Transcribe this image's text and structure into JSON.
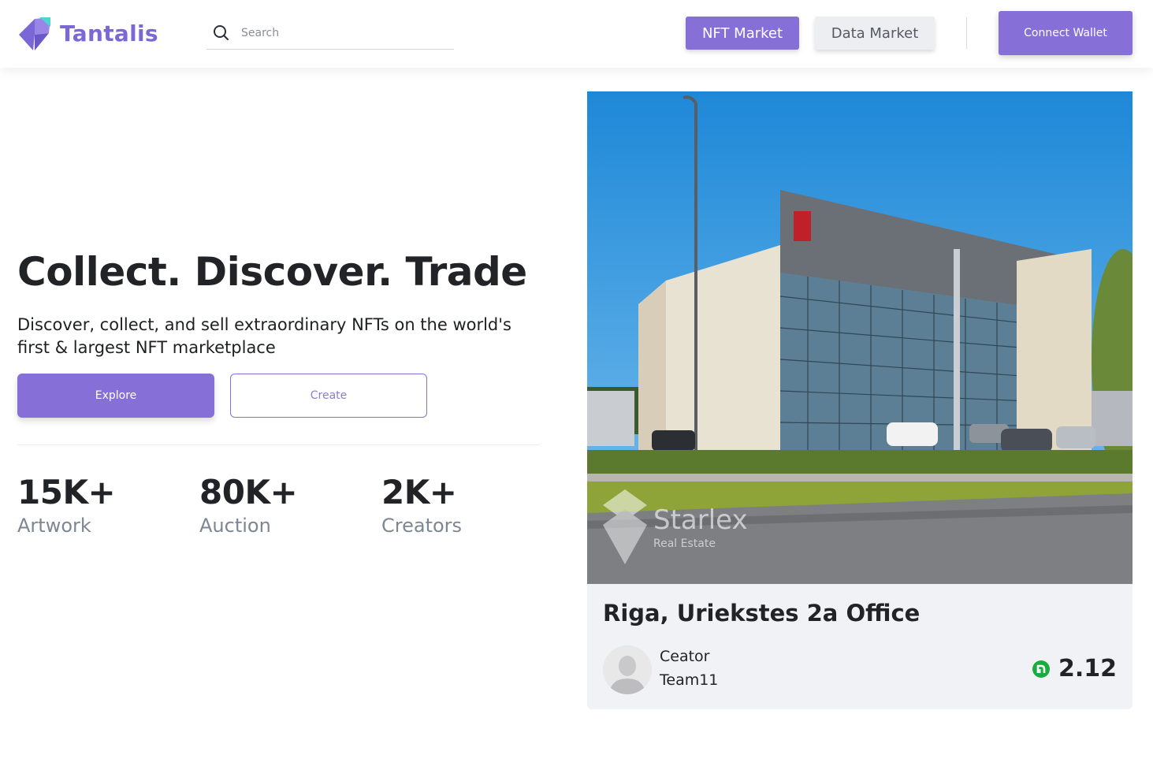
{
  "header": {
    "brand": "Tantalis",
    "search_placeholder": "Search",
    "nav": {
      "nft_market": "NFT Market",
      "data_market": "Data Market"
    },
    "connect_wallet": "Connect Wallet"
  },
  "hero": {
    "title": "Collect. Discover. Trade",
    "subtitle": "Discover, collect, and sell extraordinary NFTs on the world's first & largest NFT marketplace",
    "explore_label": "Explore",
    "create_label": "Create",
    "stats": [
      {
        "value": "15K+",
        "label": "Artwork"
      },
      {
        "value": "80K+",
        "label": "Auction"
      },
      {
        "value": "2K+",
        "label": "Creators"
      }
    ]
  },
  "card": {
    "image_watermark": "Starlex",
    "image_watermark_sub": "Real Estate",
    "title": "Riga, Uriekstes 2a Office",
    "creator_label": "Ceator",
    "creator_name": "Team11",
    "price": "2.12",
    "price_icon": "currency-coin-icon"
  },
  "colors": {
    "accent": "#8670d8",
    "brand_text": "#7b68d6",
    "muted": "#7d8793",
    "card_bg": "#f0f2f6",
    "coin": "#1aac3f"
  }
}
